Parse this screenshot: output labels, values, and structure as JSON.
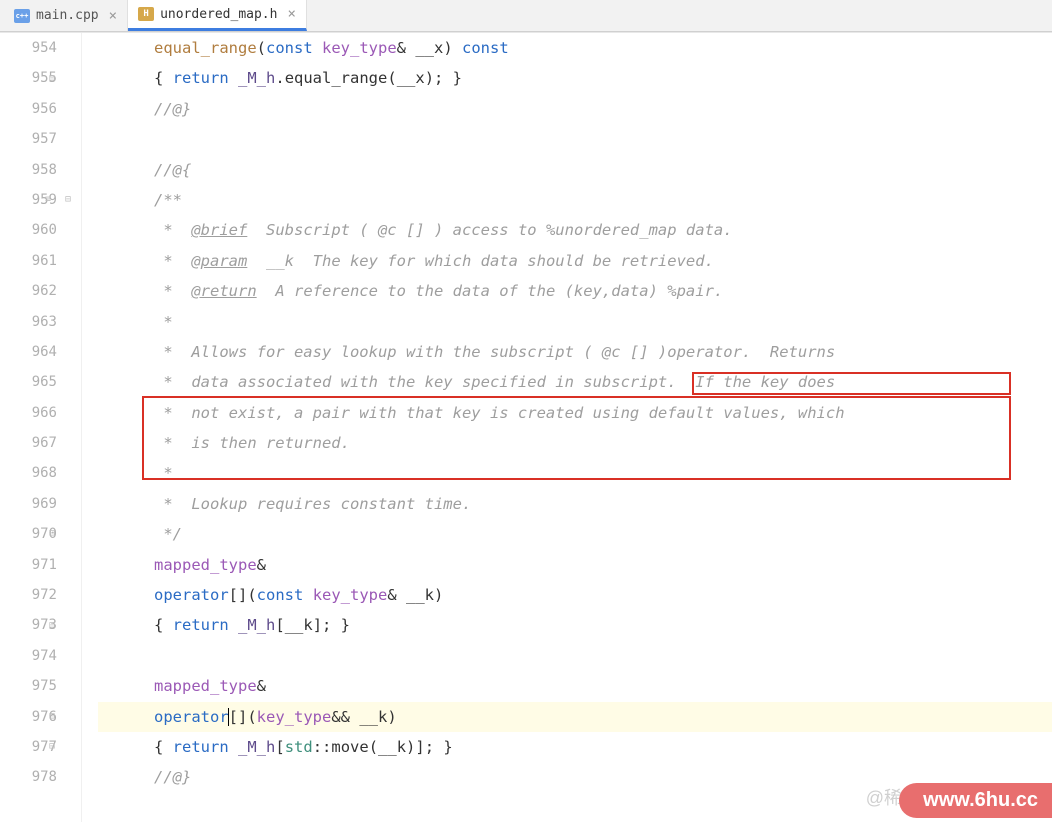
{
  "tabs": [
    {
      "label": "main.cpp",
      "active": false,
      "icon_color": "#6aa0e8",
      "icon_text": "c++"
    },
    {
      "label": "unordered_map.h",
      "active": true,
      "icon_color": "#d6a84a",
      "icon_text": "H"
    }
  ],
  "line_numbers": [
    "954",
    "955",
    "956",
    "957",
    "958",
    "959",
    "960",
    "961",
    "962",
    "963",
    "964",
    "965",
    "966",
    "967",
    "968",
    "969",
    "970",
    "971",
    "972",
    "973",
    "974",
    "975",
    "976",
    "977",
    "978"
  ],
  "code": {
    "l954": {
      "indent": "      ",
      "fn": "equal_range",
      "p1": "(",
      "kw_const": "const",
      "sp1": " ",
      "type": "key_type",
      "amp": "& ",
      "var": "__x",
      "p2": ") ",
      "kw_const2": "const"
    },
    "l955": {
      "indent": "      ",
      "b1": "{ ",
      "ret": "return",
      "sp": " ",
      "mh": "_M_h",
      "dot": ".",
      "fn": "equal_range",
      "p1": "(",
      "var": "__x",
      "p2": "); }"
    },
    "l956": {
      "indent": "      ",
      "text": "//@}"
    },
    "l957": "",
    "l958": {
      "indent": "      ",
      "text": "//@{"
    },
    "l959": {
      "indent": "      ",
      "text": "/**"
    },
    "l960": {
      "indent": "       ",
      "star": "*  ",
      "tag": "@brief",
      "rest": "  Subscript ( @c [] ) access to %unordered_map data."
    },
    "l961": {
      "indent": "       ",
      "star": "*  ",
      "tag": "@param",
      "rest": "  __k  The key for which data should be retrieved."
    },
    "l962": {
      "indent": "       ",
      "star": "*  ",
      "tag": "@return",
      "rest": "  A reference to the data of the (key,data) %pair."
    },
    "l963": {
      "indent": "       ",
      "text": "*"
    },
    "l964": {
      "indent": "       ",
      "text": "*  Allows for easy lookup with the subscript ( @c [] )operator.  Returns"
    },
    "l965": {
      "indent": "       ",
      "text": "*  data associated with the key specified in subscript.  If the key does"
    },
    "l966": {
      "indent": "       ",
      "text": "*  not exist, a pair with that key is created using default values, which"
    },
    "l967": {
      "indent": "       ",
      "text": "*  is then returned."
    },
    "l968": {
      "indent": "       ",
      "text": "*"
    },
    "l969": {
      "indent": "       ",
      "text": "*  Lookup requires constant time."
    },
    "l970": {
      "indent": "       ",
      "text": "*/"
    },
    "l971": {
      "indent": "      ",
      "type": "mapped_type",
      "amp": "&"
    },
    "l972": {
      "indent": "      ",
      "op": "operator",
      "br": "[]",
      "p1": "(",
      "kw_const": "const",
      "sp": " ",
      "type": "key_type",
      "amp": "& ",
      "var": "__k",
      "p2": ")"
    },
    "l973": {
      "indent": "      ",
      "b1": "{ ",
      "ret": "return",
      "sp": " ",
      "mh": "_M_h",
      "br1": "[",
      "var": "__k",
      "br2": "]; }"
    },
    "l974": "",
    "l975": {
      "indent": "      ",
      "type": "mapped_type",
      "amp": "&"
    },
    "l976": {
      "indent": "      ",
      "op": "operator",
      "br": "[]",
      "p1": "(",
      "type": "key_type",
      "amp": "&& ",
      "var": "__k",
      "p2": ")"
    },
    "l977": {
      "indent": "      ",
      "b1": "{ ",
      "ret": "return",
      "sp": " ",
      "mh": "_M_h",
      "br1": "[",
      "std": "std",
      "cc": "::",
      "move": "move",
      "p1": "(",
      "var": "__k",
      "p2": ")]; }"
    },
    "l978": {
      "indent": "      ",
      "text": "//@}"
    }
  },
  "watermark": "@稀",
  "brand": "www.6hu.cc"
}
